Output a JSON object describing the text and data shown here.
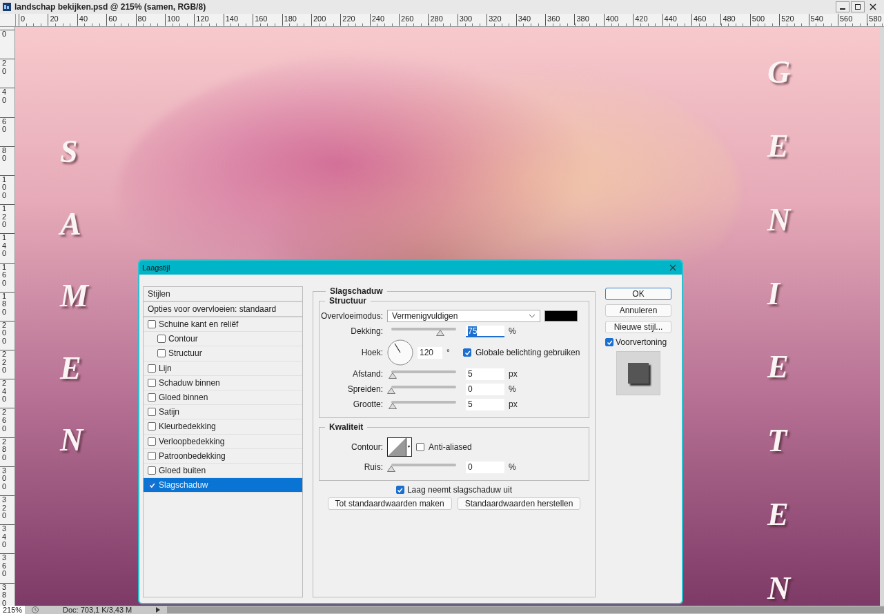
{
  "window": {
    "title": "landschap bekijken.psd @ 215% (samen, RGB/8)"
  },
  "rulers": {
    "horizontal": [
      "0",
      "20",
      "40",
      "60",
      "80",
      "100",
      "120",
      "140",
      "160",
      "180",
      "200",
      "220",
      "240",
      "260",
      "280",
      "300",
      "320",
      "340",
      "360",
      "380",
      "400",
      "420",
      "440",
      "460",
      "480",
      "500",
      "520",
      "540",
      "560",
      "580"
    ],
    "vertical": [
      "0",
      "20",
      "40",
      "60",
      "80",
      "100",
      "120",
      "140",
      "160",
      "180",
      "200",
      "220",
      "240",
      "260",
      "280",
      "300",
      "320",
      "340",
      "360",
      "380"
    ]
  },
  "canvas": {
    "letters_left": [
      "S",
      "A",
      "M",
      "E",
      "N"
    ],
    "letters_right": [
      "G",
      "E",
      "N",
      "I",
      "E",
      "T",
      "E",
      "N"
    ]
  },
  "dialog": {
    "title": "Laagstijl",
    "styles_header": "Stijlen",
    "blend_options": "Opties voor overvloeien: standaard",
    "effects": [
      {
        "label": "Schuine kant en reliëf",
        "checked": false,
        "selected": false,
        "children": [
          {
            "label": "Contour",
            "checked": false,
            "selected": false
          },
          {
            "label": "Structuur",
            "checked": false,
            "selected": false
          }
        ]
      },
      {
        "label": "Lijn",
        "checked": false,
        "selected": false
      },
      {
        "label": "Schaduw binnen",
        "checked": false,
        "selected": false
      },
      {
        "label": "Gloed binnen",
        "checked": false,
        "selected": false
      },
      {
        "label": "Satijn",
        "checked": false,
        "selected": false
      },
      {
        "label": "Kleurbedekking",
        "checked": false,
        "selected": false
      },
      {
        "label": "Verloopbedekking",
        "checked": false,
        "selected": false
      },
      {
        "label": "Patroonbedekking",
        "checked": false,
        "selected": false
      },
      {
        "label": "Gloed buiten",
        "checked": false,
        "selected": false
      },
      {
        "label": "Slagschaduw",
        "checked": true,
        "selected": true
      }
    ],
    "section_title": "Slagschaduw",
    "structure": {
      "title": "Structuur",
      "blend_mode": {
        "label": "Overvloeimodus:",
        "value": "Vermenigvuldigen"
      },
      "rows": [
        {
          "kind": "slider",
          "label": "Dekking:",
          "level": 0.75,
          "value": "75",
          "unit": "%"
        },
        {
          "kind": "angle",
          "label": "Hoek:",
          "value": "120",
          "unit": "°",
          "check_label": "Globale belichting gebruiken",
          "checked": true
        },
        {
          "kind": "slider",
          "label": "Afstand:",
          "level": 0.02,
          "value": "5",
          "unit": "px"
        },
        {
          "kind": "slider",
          "label": "Spreiden:",
          "level": 0,
          "value": "0",
          "unit": "%"
        },
        {
          "kind": "slider",
          "label": "Grootte:",
          "level": 0.02,
          "value": "5",
          "unit": "px"
        }
      ]
    },
    "quality": {
      "title": "Kwaliteit",
      "contour_label": "Contour:",
      "anti_aliased": {
        "label": "Anti-aliased",
        "checked": false
      },
      "noise": {
        "label": "Ruis:",
        "level": 0,
        "value": "0",
        "unit": "%"
      }
    },
    "knockout": {
      "label": "Laag neemt slagschaduw uit",
      "checked": true
    },
    "bottom_buttons": [
      "Tot standaardwaarden maken",
      "Standaardwaarden herstellen"
    ],
    "side_buttons": [
      "OK",
      "Annuleren",
      "Nieuwe stijl..."
    ],
    "preview": {
      "label": "Voorvertoning",
      "checked": true
    }
  },
  "status_bar": {
    "zoom": "215%",
    "doc": "Doc: 703,1 K/3,43 M"
  }
}
